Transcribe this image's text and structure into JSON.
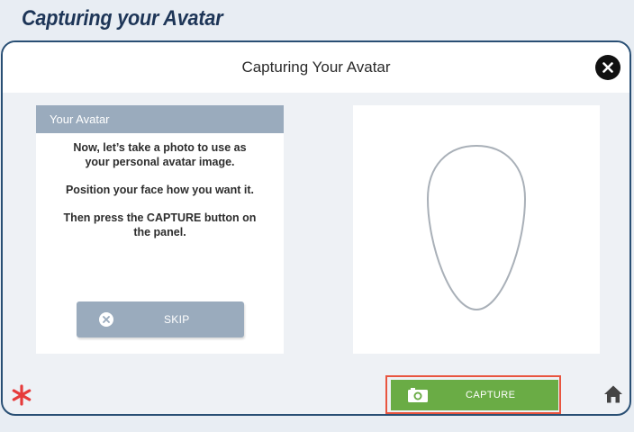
{
  "page_heading": "Capturing your Avatar",
  "dialog": {
    "title": "Capturing Your Avatar",
    "close_icon": "close-icon"
  },
  "avatar_panel": {
    "header": "Your Avatar",
    "instructions": [
      "Now, let’s take a photo to use as your personal avatar image.",
      "Position your face how you want it.",
      "Then press the CAPTURE button on the panel."
    ],
    "skip_label": "SKIP",
    "skip_icon": "close-circle-icon"
  },
  "camera_preview": {
    "face_guide": "face-outline"
  },
  "footer": {
    "capture_label": "CAPTURE",
    "capture_icon": "camera-icon",
    "left_icon": "asterisk-icon",
    "home_icon": "home-icon"
  },
  "colors": {
    "capture_green": "#6aac45",
    "panel_header": "#9aabbd",
    "highlight": "#e8553f",
    "asterisk": "#e63b3b",
    "dialog_border": "#294f74"
  }
}
